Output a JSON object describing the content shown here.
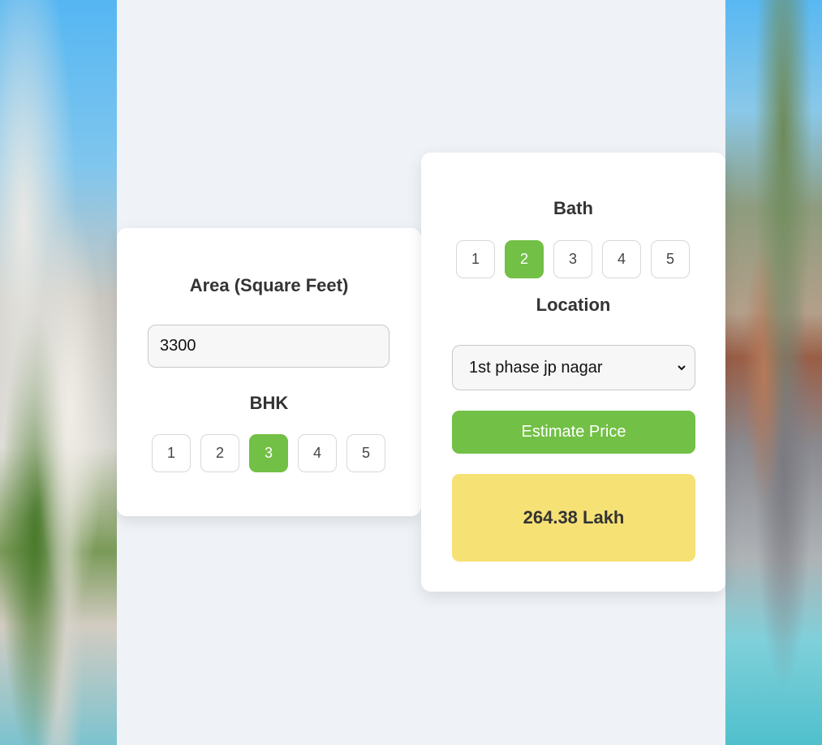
{
  "area_card": {
    "heading": "Area (Square Feet)",
    "area_value": "3300",
    "bhk_heading": "BHK",
    "bhk_options": [
      "1",
      "2",
      "3",
      "4",
      "5"
    ],
    "bhk_selected": "3"
  },
  "bath_card": {
    "heading": "Bath",
    "bath_options": [
      "1",
      "2",
      "3",
      "4",
      "5"
    ],
    "bath_selected": "2",
    "location_heading": "Location",
    "location_selected": "1st phase jp nagar",
    "estimate_label": "Estimate Price",
    "result": "264.38 Lakh"
  },
  "colors": {
    "accent_green": "#72c045",
    "result_yellow": "#f6e175",
    "panel_bg": "#eff2f7"
  }
}
